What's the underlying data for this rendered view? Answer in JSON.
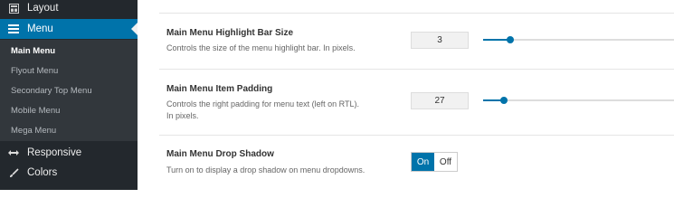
{
  "sidebar": {
    "items": [
      {
        "label": "Layout",
        "icon": "layout-icon"
      },
      {
        "label": "Menu",
        "icon": "hamburger-menu-icon"
      },
      {
        "label": "Responsive",
        "icon": "resize-arrows-icon"
      },
      {
        "label": "Colors",
        "icon": "brush-icon"
      }
    ],
    "submenu": [
      {
        "label": "Main Menu"
      },
      {
        "label": "Flyout Menu"
      },
      {
        "label": "Secondary Top Menu"
      },
      {
        "label": "Mobile Menu"
      },
      {
        "label": "Mega Menu"
      }
    ]
  },
  "options": {
    "highlight_bar": {
      "title": "Main Menu Highlight Bar Size",
      "description": "Controls the size of the menu highlight bar. In pixels.",
      "value": "3",
      "slider_fraction": 0.14
    },
    "item_padding": {
      "title": "Main Menu Item Padding",
      "description": "Controls the right padding for menu text (left on RTL). In pixels.",
      "value": "27",
      "slider_fraction": 0.11
    },
    "drop_shadow": {
      "title": "Main Menu Drop Shadow",
      "description": "Turn on to display a drop shadow on menu dropdowns.",
      "on_label": "On",
      "off_label": "Off",
      "state": "on"
    }
  },
  "colors": {
    "sidebar_bg": "#23282d",
    "submenu_bg": "#32373c",
    "accent": "#0073aa"
  }
}
